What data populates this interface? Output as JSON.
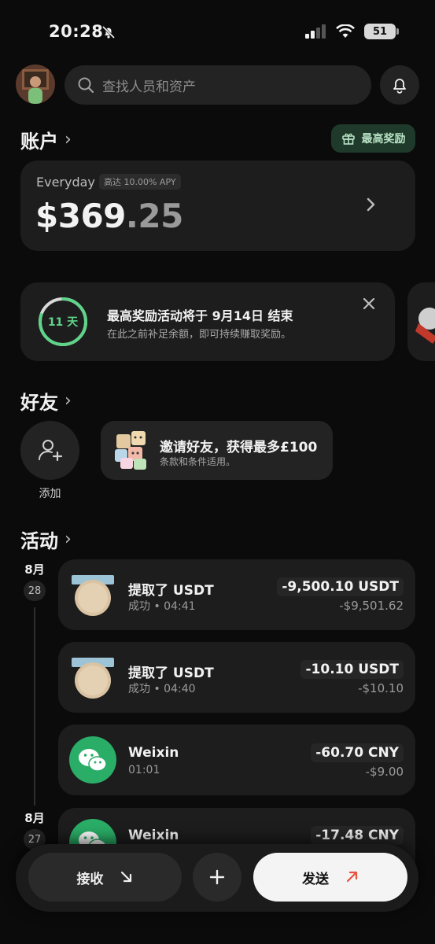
{
  "status_bar": {
    "time": "20:28",
    "battery": "51"
  },
  "header": {
    "search_placeholder": "查找人员和资产"
  },
  "account_section": {
    "title": "账户",
    "reward_label": "最高奖励",
    "card": {
      "name": "Everyday",
      "apy_badge": "高达 10.00% APY",
      "balance_whole": "$369",
      "balance_decimal": ".25"
    }
  },
  "promo": {
    "ring_label": "11 天",
    "ring_progress": 0.8,
    "title": "最高奖励活动将于 9月14日 结束",
    "subtitle": "在此之前补足余额，即可持续赚取奖励。"
  },
  "friends_section": {
    "title": "好友",
    "add_label": "添加",
    "invite_title": "邀请好友，获得最多£100",
    "invite_subtitle": "条款和条件适用。"
  },
  "activity_section": {
    "title": "活动",
    "groups": [
      {
        "month": "8月",
        "day": "28"
      },
      {
        "month": "8月",
        "day": "27"
      }
    ],
    "transactions": [
      {
        "title": "提取了 USDT",
        "subtitle": "成功 • 04:41",
        "amount": "-9,500.10 USDT",
        "fiat": "-$9,501.62",
        "icon": "usdt-withdraw-icon"
      },
      {
        "title": "提取了 USDT",
        "subtitle": "成功 • 04:40",
        "amount": "-10.10 USDT",
        "fiat": "-$10.10",
        "icon": "usdt-withdraw-icon"
      },
      {
        "title": "Weixin",
        "subtitle": "01:01",
        "amount": "-60.70 CNY",
        "fiat": "-$9.00",
        "icon": "wechat-icon"
      },
      {
        "title": "Weixin",
        "subtitle": "",
        "amount": "-17.48 CNY",
        "fiat": "",
        "icon": "wechat-icon"
      }
    ]
  },
  "bottom_bar": {
    "receive_label": "接收",
    "send_label": "发送"
  },
  "colors": {
    "accent_green": "#5fd489",
    "wechat_green": "#2aae67",
    "send_arrow": "#e5533d"
  }
}
